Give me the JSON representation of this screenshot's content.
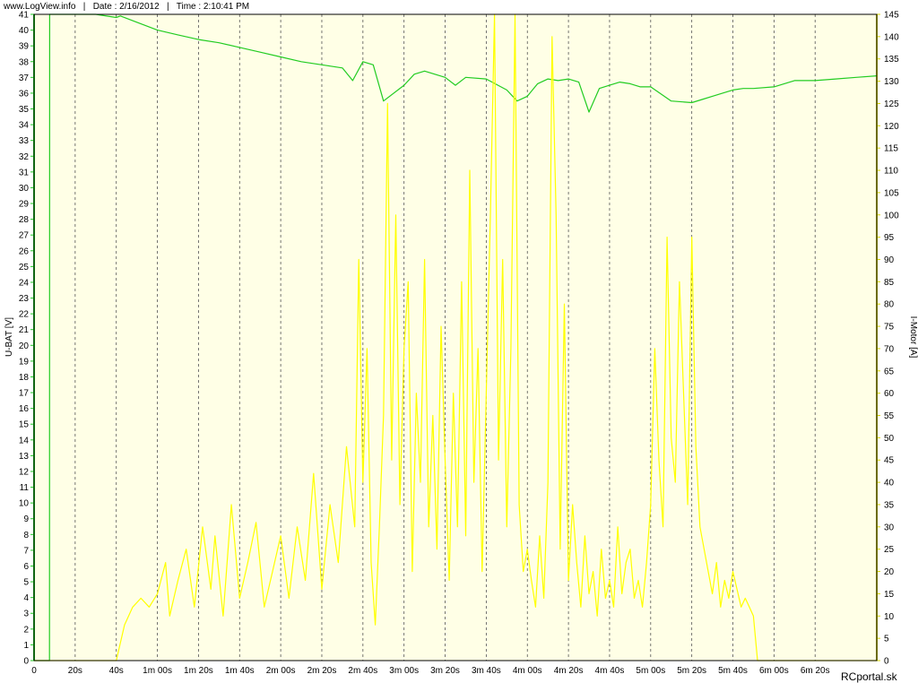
{
  "header": {
    "site": "www.LogView.info",
    "date": "Date : 2/16/2012",
    "time": "Time : 2:10:41 PM"
  },
  "watermark": "RCportal.sk",
  "colors": {
    "plot_background": "#ffffe6",
    "voltage": "#22cc22",
    "current": "#ffff00",
    "grid": "#555555"
  },
  "chart_data": {
    "type": "line",
    "x_ticks": [
      "0",
      "20s",
      "40s",
      "1m 00s",
      "1m 20s",
      "1m 40s",
      "2m 00s",
      "2m 20s",
      "2m 40s",
      "3m 00s",
      "3m 20s",
      "3m 40s",
      "4m 00s",
      "4m 20s",
      "4m 40s",
      "5m 00s",
      "5m 20s",
      "5m 40s",
      "6m 00s",
      "6m 20s"
    ],
    "xlim": [
      0,
      410
    ],
    "xlabel": "",
    "left_axis": {
      "label": "U-BAT [V]",
      "ylim": [
        0,
        41
      ],
      "ticks": [
        0,
        1,
        2,
        3,
        4,
        5,
        6,
        7,
        8,
        9,
        10,
        11,
        12,
        13,
        14,
        15,
        16,
        17,
        18,
        19,
        20,
        21,
        22,
        23,
        24,
        25,
        26,
        27,
        28,
        29,
        30,
        31,
        32,
        33,
        34,
        35,
        36,
        37,
        38,
        39,
        40,
        41
      ]
    },
    "right_axis": {
      "label": "I-Motor [A]",
      "ylim": [
        0,
        145
      ],
      "ticks": [
        0,
        5,
        10,
        15,
        20,
        25,
        30,
        35,
        40,
        45,
        50,
        55,
        60,
        65,
        70,
        75,
        80,
        85,
        90,
        95,
        100,
        105,
        110,
        115,
        120,
        125,
        130,
        135,
        140,
        145
      ]
    },
    "series": [
      {
        "name": "U-BAT [V]",
        "axis": "left",
        "x": [
          0,
          7.5,
          7.6,
          20,
          30,
          40,
          42,
          50,
          60,
          70,
          80,
          90,
          100,
          110,
          120,
          130,
          140,
          150,
          155,
          160,
          165,
          170,
          180,
          185,
          190,
          200,
          205,
          210,
          220,
          230,
          235,
          240,
          245,
          250,
          255,
          260,
          265,
          270,
          275,
          280,
          285,
          290,
          295,
          300,
          310,
          320,
          325,
          330,
          335,
          340,
          345,
          350,
          360,
          370,
          380,
          390,
          400,
          410
        ],
        "values": [
          0,
          0,
          41.3,
          41.2,
          41.0,
          40.8,
          40.9,
          40.5,
          40.0,
          39.7,
          39.4,
          39.2,
          38.9,
          38.6,
          38.3,
          38.0,
          37.8,
          37.6,
          36.8,
          38.0,
          37.8,
          35.5,
          36.5,
          37.2,
          37.4,
          37.0,
          36.5,
          37.0,
          36.9,
          36.2,
          35.5,
          35.8,
          36.6,
          36.9,
          36.8,
          36.9,
          36.7,
          34.8,
          36.3,
          36.5,
          36.7,
          36.6,
          36.4,
          36.4,
          35.5,
          35.4,
          35.6,
          35.8,
          36.0,
          36.2,
          36.3,
          36.3,
          36.4,
          36.8,
          36.8,
          36.9,
          37.0,
          37.1
        ]
      },
      {
        "name": "I-Motor [A]",
        "axis": "right",
        "x": [
          0,
          40,
          42,
          44,
          48,
          52,
          56,
          60,
          64,
          66,
          70,
          74,
          78,
          82,
          86,
          88,
          92,
          96,
          100,
          104,
          108,
          112,
          116,
          120,
          124,
          128,
          132,
          136,
          140,
          144,
          148,
          152,
          156,
          158,
          160,
          162,
          164,
          166,
          168,
          170,
          172,
          174,
          176,
          178,
          180,
          182,
          184,
          186,
          188,
          190,
          192,
          194,
          196,
          198,
          200,
          202,
          204,
          206,
          208,
          210,
          212,
          214,
          216,
          218,
          220,
          222,
          224,
          226,
          228,
          230,
          232,
          234,
          236,
          238,
          240,
          242,
          244,
          246,
          248,
          250,
          252,
          254,
          256,
          258,
          260,
          262,
          264,
          266,
          268,
          270,
          272,
          274,
          276,
          278,
          280,
          282,
          284,
          286,
          288,
          290,
          292,
          294,
          296,
          298,
          300,
          302,
          304,
          306,
          308,
          310,
          312,
          314,
          316,
          318,
          320,
          322,
          324,
          326,
          328,
          330,
          332,
          334,
          336,
          338,
          340,
          342,
          344,
          346,
          348,
          350,
          352,
          354,
          356,
          358,
          360,
          362,
          364,
          366,
          368,
          370,
          375,
          380,
          390,
          400,
          410
        ],
        "values": [
          0,
          0,
          4,
          8,
          12,
          14,
          12,
          15,
          22,
          10,
          18,
          25,
          12,
          30,
          16,
          28,
          10,
          35,
          14,
          22,
          31,
          12,
          20,
          28,
          14,
          30,
          18,
          42,
          16,
          35,
          22,
          48,
          30,
          90,
          40,
          70,
          22,
          8,
          30,
          55,
          125,
          45,
          100,
          35,
          70,
          85,
          20,
          60,
          40,
          90,
          30,
          55,
          25,
          75,
          45,
          18,
          60,
          30,
          85,
          28,
          110,
          40,
          70,
          20,
          60,
          100,
          145,
          45,
          90,
          30,
          70,
          150,
          35,
          20,
          25,
          18,
          12,
          28,
          14,
          40,
          140,
          100,
          25,
          80,
          18,
          35,
          22,
          12,
          28,
          15,
          20,
          10,
          25,
          14,
          18,
          12,
          30,
          15,
          22,
          25,
          14,
          18,
          12,
          22,
          35,
          70,
          45,
          30,
          95,
          50,
          40,
          85,
          60,
          35,
          95,
          48,
          30,
          25,
          20,
          15,
          22,
          12,
          18,
          14,
          20,
          16,
          12,
          14,
          12,
          10,
          0,
          0,
          0,
          0,
          0,
          0,
          0,
          0,
          0,
          0,
          0,
          0,
          0,
          0,
          0
        ]
      }
    ]
  }
}
